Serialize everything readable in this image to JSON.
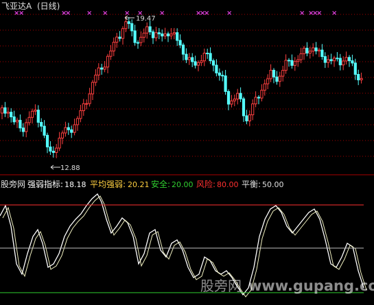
{
  "header": {
    "stock_title": "飞亚达A",
    "period": "(日线)"
  },
  "price_panel": {
    "high_label": "19.47",
    "low_label": "12.88",
    "signal_mark": "×",
    "signal_color": "#e040e0",
    "up_color": "#ff4040",
    "down_color": "#54ffff",
    "grid_color": "#aa0000"
  },
  "indicator_panel": {
    "source": "股旁网",
    "name_label": "强弱指标:",
    "name_value": "18.18",
    "avg_label": "平均强弱:",
    "avg_value": "20.21",
    "safe_label": "安全:",
    "safe_value": "20.00",
    "risk_label": "风险:",
    "risk_value": "80.00",
    "balance_label": "平衡:",
    "balance_value": "50.00",
    "risk_color": "#ff3030",
    "safe_color": "#30d030",
    "balance_color": "#c0c0c0",
    "avg_color": "#ffd040"
  },
  "watermark": {
    "cn": "股旁网",
    "url": "www.gupang.com"
  }
}
